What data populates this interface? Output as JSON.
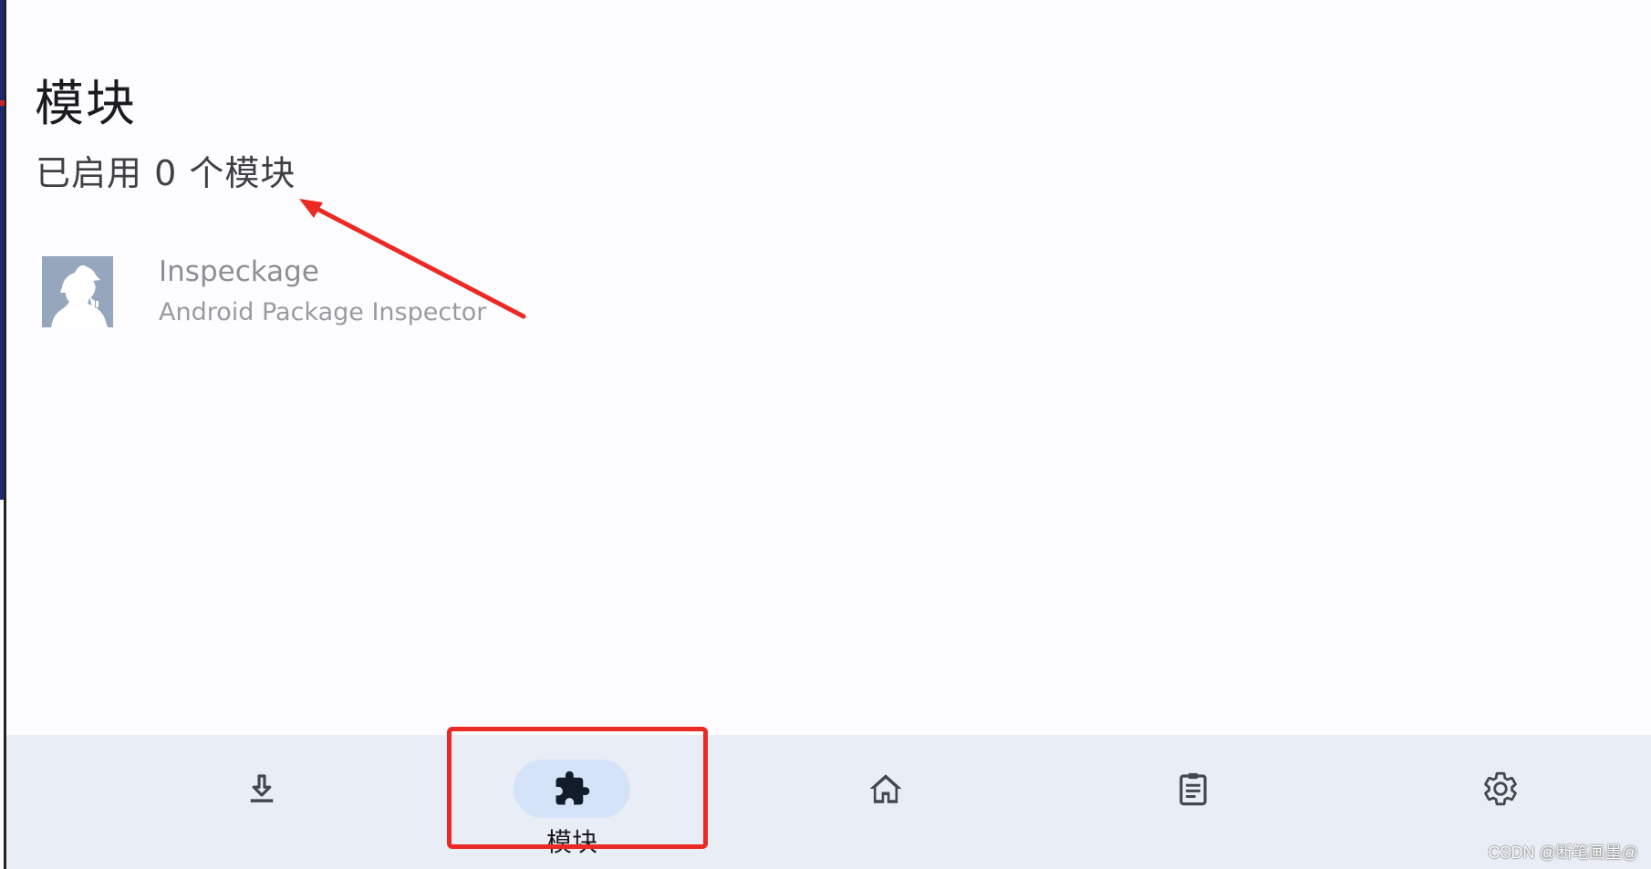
{
  "page": {
    "title": "模块",
    "subtitle": "已启用 0 个模块"
  },
  "modules": [
    {
      "name": "Inspeckage",
      "description": "Android Package Inspector",
      "icon": "detective-silhouette-icon",
      "enabled": false
    }
  ],
  "bottom_nav": {
    "items": [
      {
        "id": "repository",
        "icon": "download-icon",
        "label": "",
        "active": false
      },
      {
        "id": "modules",
        "icon": "puzzle-icon",
        "label": "模块",
        "active": true
      },
      {
        "id": "home",
        "icon": "home-icon",
        "label": "",
        "active": false
      },
      {
        "id": "logs",
        "icon": "clipboard-icon",
        "label": "",
        "active": false
      },
      {
        "id": "settings",
        "icon": "gear-icon",
        "label": "",
        "active": false
      }
    ]
  },
  "watermark": "CSDN @断笔画墨@",
  "colors": {
    "background": "#fdfcff",
    "nav_background": "#e9eef6",
    "nav_active_pill": "#d4e3f7",
    "annotation_red": "#ea2a23",
    "module_icon_bg": "#96a7bd"
  }
}
